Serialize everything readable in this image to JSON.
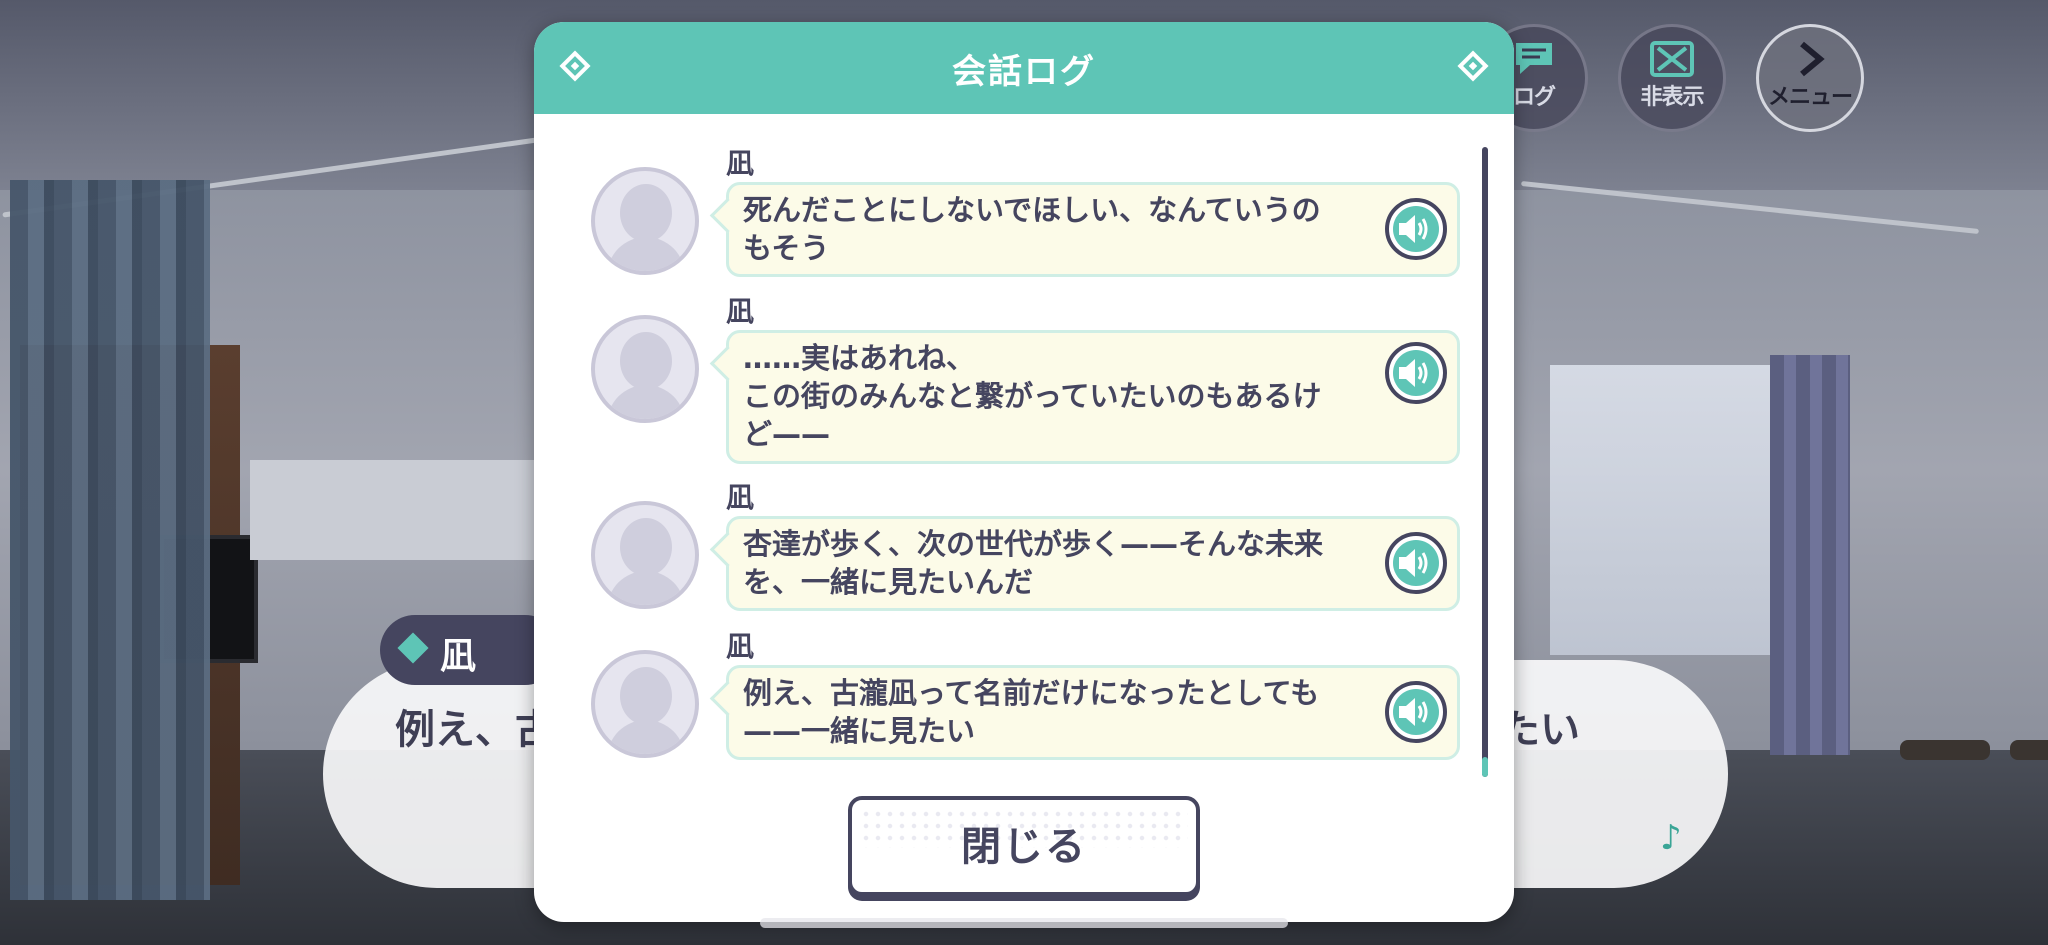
{
  "hud": {
    "log_label": "ログ",
    "hide_label": "非表示",
    "menu_label": "メニュー"
  },
  "message_window": {
    "speaker": "凪",
    "text_left": "例え、古",
    "text_right": "たい"
  },
  "dialog": {
    "title": "会話ログ",
    "entries": [
      {
        "speaker": "凪",
        "text": "死んだことにしないでほしい、なんていうの\nもそう"
      },
      {
        "speaker": "凪",
        "text": "……実はあれね、\nこの街のみんなと繋がっていたいのもあるけ\nど——"
      },
      {
        "speaker": "凪",
        "text": "杏達が歩く、次の世代が歩く——そんな未来\nを、一緒に見たいんだ"
      },
      {
        "speaker": "凪",
        "text": "例え、古瀧凪って名前だけになったとしても\n——一緒に見たい"
      }
    ],
    "close_label": "閉じる"
  },
  "colors": {
    "accent": "#5ec5b6",
    "dark": "#45455f",
    "bubble": "#fcfbe8"
  },
  "icons": {
    "log": "speech-bubble-icon",
    "hide": "x-box-icon",
    "menu": "chevron-right-icon",
    "voice": "speaker-icon",
    "music": "music-note-icon"
  }
}
